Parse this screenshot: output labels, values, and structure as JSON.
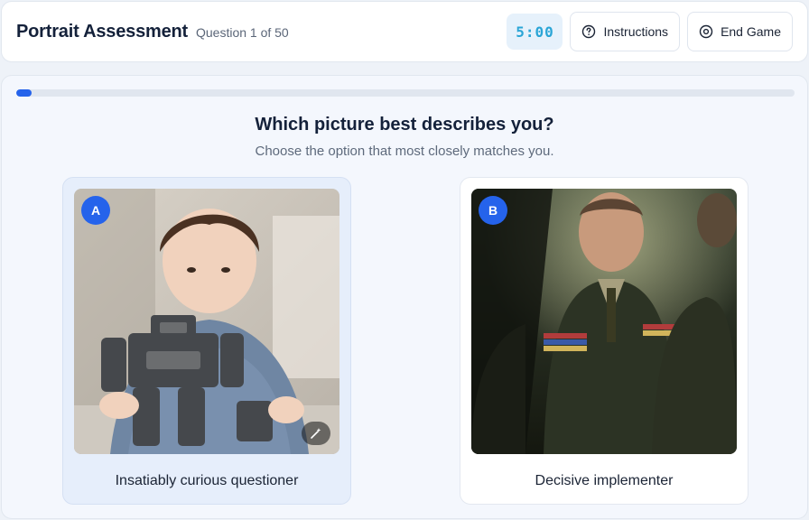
{
  "header": {
    "title": "Portrait Assessment",
    "counter": "Question 1 of 50",
    "timer": "5:00",
    "instructions_label": "Instructions",
    "end_game_label": "End Game"
  },
  "progress": {
    "current": 1,
    "total": 50,
    "fraction": 0.02
  },
  "question": {
    "text": "Which picture best describes you?",
    "subtitle": "Choose the option that most closely matches you."
  },
  "options": [
    {
      "letter": "A",
      "label": "Insatiably curious questioner",
      "selected": true
    },
    {
      "letter": "B",
      "label": "Decisive implementer",
      "selected": false
    }
  ],
  "colors": {
    "accent": "#2563eb",
    "timer": "#2aa5d6",
    "selected_bg": "#e6eefb"
  }
}
